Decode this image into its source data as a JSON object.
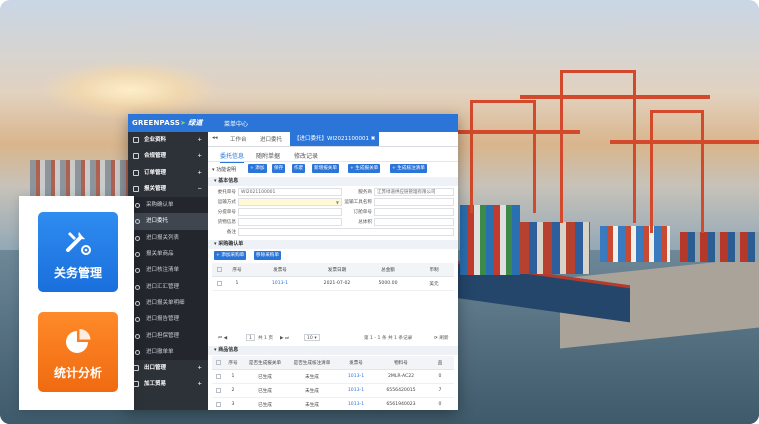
{
  "app": {
    "logo_text": "GREENPASS",
    "logo_arrow": "➤",
    "logo_cn": "绿道",
    "top_menu": "菜单中心"
  },
  "sidebar": {
    "items": [
      {
        "label": "企业资料",
        "type": "group",
        "sign": "+"
      },
      {
        "label": "合规管理",
        "type": "group",
        "sign": "+"
      },
      {
        "label": "订单管理",
        "type": "group",
        "sign": "+"
      },
      {
        "label": "报关管理",
        "type": "group",
        "sign": "−"
      },
      {
        "label": "采购确认单",
        "type": "sub"
      },
      {
        "label": "进口委托",
        "type": "sub",
        "active": true
      },
      {
        "label": "进口报关列表",
        "type": "sub"
      },
      {
        "label": "报关单商品",
        "type": "sub"
      },
      {
        "label": "进口核注清单",
        "type": "sub"
      },
      {
        "label": "进口汇汇管理",
        "type": "sub"
      },
      {
        "label": "进口报关单明细",
        "type": "sub"
      },
      {
        "label": "进口报告管理",
        "type": "sub"
      },
      {
        "label": "进口担保管理",
        "type": "sub"
      },
      {
        "label": "进口撤单单",
        "type": "sub"
      },
      {
        "label": "出口管理",
        "type": "group",
        "sign": "+"
      },
      {
        "label": "加工贸易",
        "type": "group",
        "sign": "+"
      }
    ]
  },
  "tabs": {
    "nav": "◂◂",
    "items": [
      "工作台",
      "进口委托",
      "【进口委托】WI2021100001 ✖"
    ]
  },
  "subtabs": [
    "委托信息",
    "随附单据",
    "修改记录"
  ],
  "toolbar": {
    "label": "▾ 功能说明",
    "buttons": [
      "+ 添加",
      "保存",
      "作废",
      "新增报关单",
      "+ 生成报关单",
      "+ 生成核注清单"
    ]
  },
  "basic": {
    "title": "▾ 基本信息",
    "left": [
      {
        "label": "委托单号",
        "value": "WI2021100001"
      },
      {
        "label": "运输方式",
        "value": ""
      },
      {
        "label": "分提单号",
        "value": ""
      },
      {
        "label": "货物信息",
        "value": ""
      },
      {
        "label": "备注",
        "value": ""
      }
    ],
    "right": [
      {
        "label": "服务商",
        "value": "江苏绿道供应链管理有限公司"
      },
      {
        "label": "运输工具名称",
        "value": ""
      },
      {
        "label": "订舱单号",
        "value": ""
      },
      {
        "label": "总体积",
        "value": ""
      }
    ]
  },
  "purchase": {
    "title": "▾ 采购确认单",
    "buttons": [
      "+ 添加采购单",
      "移除采购单"
    ],
    "headers": [
      "序号",
      "发票号",
      "发票日期",
      "总金额",
      "币制"
    ],
    "rows": [
      [
        "1",
        "1013-1",
        "2021-07-02",
        "5000.00",
        "美元"
      ]
    ],
    "pager": {
      "page": "1",
      "of": "共 1 页",
      "size": "10",
      "summary": "第 1 - 1 条  共 1 条记录",
      "refresh": "刷新"
    }
  },
  "goods": {
    "title": "▾ 商品信息",
    "headers": [
      "序号",
      "是否生成报关单",
      "是否生成核注清单",
      "发票号",
      "物料号",
      "品"
    ],
    "rows": [
      [
        "1",
        "已生成",
        "未生成",
        "1013-1",
        "2MLR-AC22",
        "0"
      ],
      [
        "2",
        "已生成",
        "未生成",
        "1013-1",
        "6556420015",
        "7"
      ],
      [
        "3",
        "已生成",
        "未生成",
        "1013-1",
        "6561940023",
        "0"
      ]
    ]
  },
  "feature_tiles": [
    {
      "label": "关务管理",
      "icon": "tools-icon",
      "color": "#1f78e6"
    },
    {
      "label": "统计分析",
      "icon": "pie-chart-icon",
      "color": "#f27417"
    }
  ]
}
